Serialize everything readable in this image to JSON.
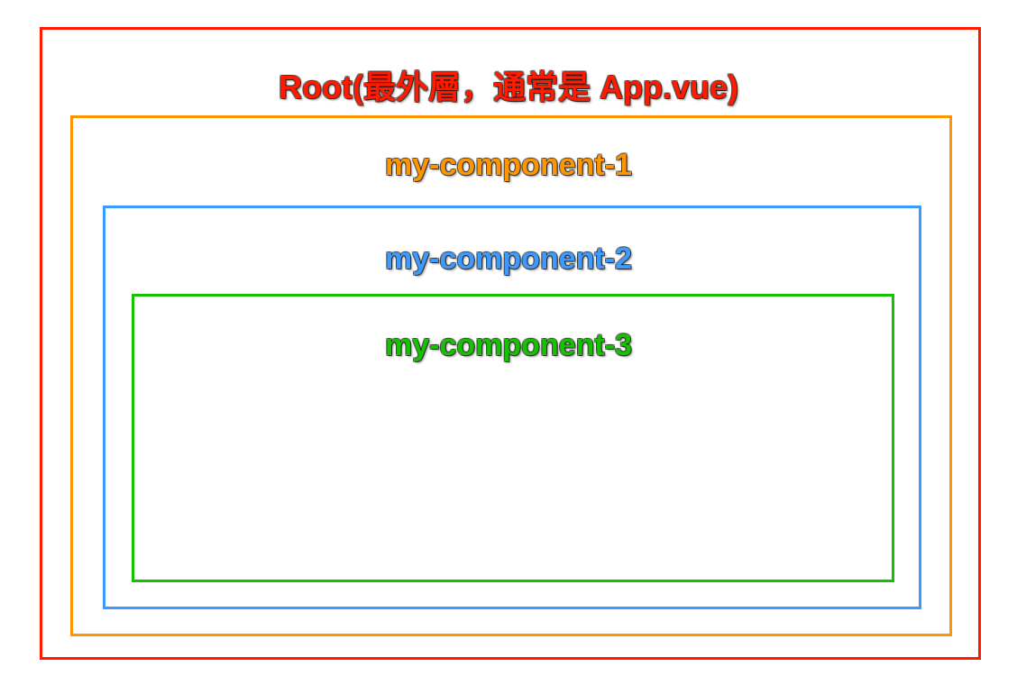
{
  "diagram": {
    "root": {
      "label": "Root(最外層，通常是 App.vue)",
      "color": "#ff1a00"
    },
    "component1": {
      "label": "my-component-1",
      "color": "#ff9500"
    },
    "component2": {
      "label": "my-component-2",
      "color": "#3d9bff"
    },
    "component3": {
      "label": "my-component-3",
      "color": "#16c200"
    }
  }
}
